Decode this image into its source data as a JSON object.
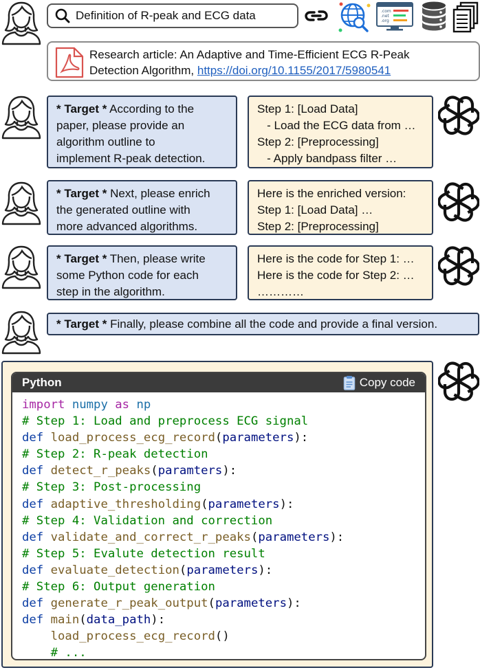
{
  "search": {
    "query": "Definition of R-peak and ECG data"
  },
  "article": {
    "text_line1": "Research article: An Adaptive and Time-Efficient ECG R-Peak",
    "text_line2_prefix": "Detection Algorithm, ",
    "link": "https://doi.org/10.1155/2017/5980541"
  },
  "target_label": "* Target *",
  "rounds": [
    {
      "prompt": " According to the paper, please provide an algorithm outline to implement R-peak detection.",
      "prompt_lines": [
        "According to the",
        "paper, please provide an",
        "algorithm outline to",
        "implement R-peak detection."
      ],
      "response": [
        "Step 1: [Load Data]",
        "   - Load the ECG data from …",
        "Step 2: [Preprocessing]",
        "   - Apply bandpass filter …"
      ]
    },
    {
      "prompt_lines": [
        "Next, please enrich",
        "the generated outline with",
        "more advanced algorithms."
      ],
      "response": [
        "Here is the enriched version:",
        "Step 1: [Load Data] …",
        "Step 2: [Preprocessing]"
      ]
    },
    {
      "prompt_lines": [
        "Then, please write",
        "some Python code for each",
        "step in the algorithm."
      ],
      "response": [
        "Here is the code for Step 1: …",
        "Here is the code for Step 2: …",
        "…………"
      ]
    },
    {
      "prompt_lines": [
        "Finally, please combine all the code and provide a final version."
      ]
    }
  ],
  "code": {
    "language": "Python",
    "copy_label": "Copy code",
    "lines": [
      [
        [
          "kw",
          "import"
        ],
        [
          "pl",
          " "
        ],
        [
          "md",
          "numpy"
        ],
        [
          "pl",
          " "
        ],
        [
          "kw",
          "as"
        ],
        [
          "pl",
          " "
        ],
        [
          "md",
          "np"
        ]
      ],
      [
        [
          "cm",
          "# Step 1: Load and preprocess ECG signal"
        ]
      ],
      [
        [
          "kwd",
          "def"
        ],
        [
          "pl",
          " "
        ],
        [
          "fn",
          "load_process_ecg_record"
        ],
        [
          "pl",
          "("
        ],
        [
          "pm",
          "parameters"
        ],
        [
          "pl",
          "):"
        ]
      ],
      [
        [
          "cm",
          "# Step 2: R-peak detection"
        ]
      ],
      [
        [
          "kwd",
          "def"
        ],
        [
          "pl",
          " "
        ],
        [
          "fn",
          "detect_r_peaks"
        ],
        [
          "pl",
          "("
        ],
        [
          "pm",
          "paramters"
        ],
        [
          "pl",
          "):"
        ]
      ],
      [
        [
          "cm",
          "# Step 3: Post-processing"
        ]
      ],
      [
        [
          "kwd",
          "def"
        ],
        [
          "pl",
          " "
        ],
        [
          "fn",
          "adaptive_thresholding"
        ],
        [
          "pl",
          "("
        ],
        [
          "pm",
          "parameters"
        ],
        [
          "pl",
          "):"
        ]
      ],
      [
        [
          "cm",
          "# Step 4: Validation and correction"
        ]
      ],
      [
        [
          "kwd",
          "def"
        ],
        [
          "pl",
          " "
        ],
        [
          "fn",
          "validate_and_correct_r_peaks"
        ],
        [
          "pl",
          "("
        ],
        [
          "pm",
          "parameters"
        ],
        [
          "pl",
          "):"
        ]
      ],
      [
        [
          "cm",
          "# Step 5: Evalute detection result"
        ]
      ],
      [
        [
          "kwd",
          "def"
        ],
        [
          "pl",
          " "
        ],
        [
          "fn",
          "evaluate_detection"
        ],
        [
          "pl",
          "("
        ],
        [
          "pm",
          "parameters"
        ],
        [
          "pl",
          "):"
        ]
      ],
      [
        [
          "cm",
          "# Step 6: Output generation"
        ]
      ],
      [
        [
          "kwd",
          "def"
        ],
        [
          "pl",
          " "
        ],
        [
          "fn",
          "generate_r_peak_output"
        ],
        [
          "pl",
          "("
        ],
        [
          "pm",
          "parameters"
        ],
        [
          "pl",
          "):"
        ]
      ],
      [
        [
          "kwd",
          "def"
        ],
        [
          "pl",
          " "
        ],
        [
          "fn",
          "main"
        ],
        [
          "pl",
          "("
        ],
        [
          "pm",
          "data_path"
        ],
        [
          "pl",
          "):"
        ]
      ],
      [
        [
          "pl",
          "    "
        ],
        [
          "fn",
          "load_process_ecg_record"
        ],
        [
          "pl",
          "()"
        ]
      ],
      [
        [
          "pl",
          "    "
        ],
        [
          "cm",
          "# ..."
        ]
      ]
    ]
  },
  "icons": [
    "user-icon",
    "search-icon",
    "link-icon",
    "web-search-icon",
    "website-icon",
    "database-icon",
    "documents-icon",
    "pdf-icon",
    "chatgpt-icon",
    "clipboard-icon"
  ]
}
